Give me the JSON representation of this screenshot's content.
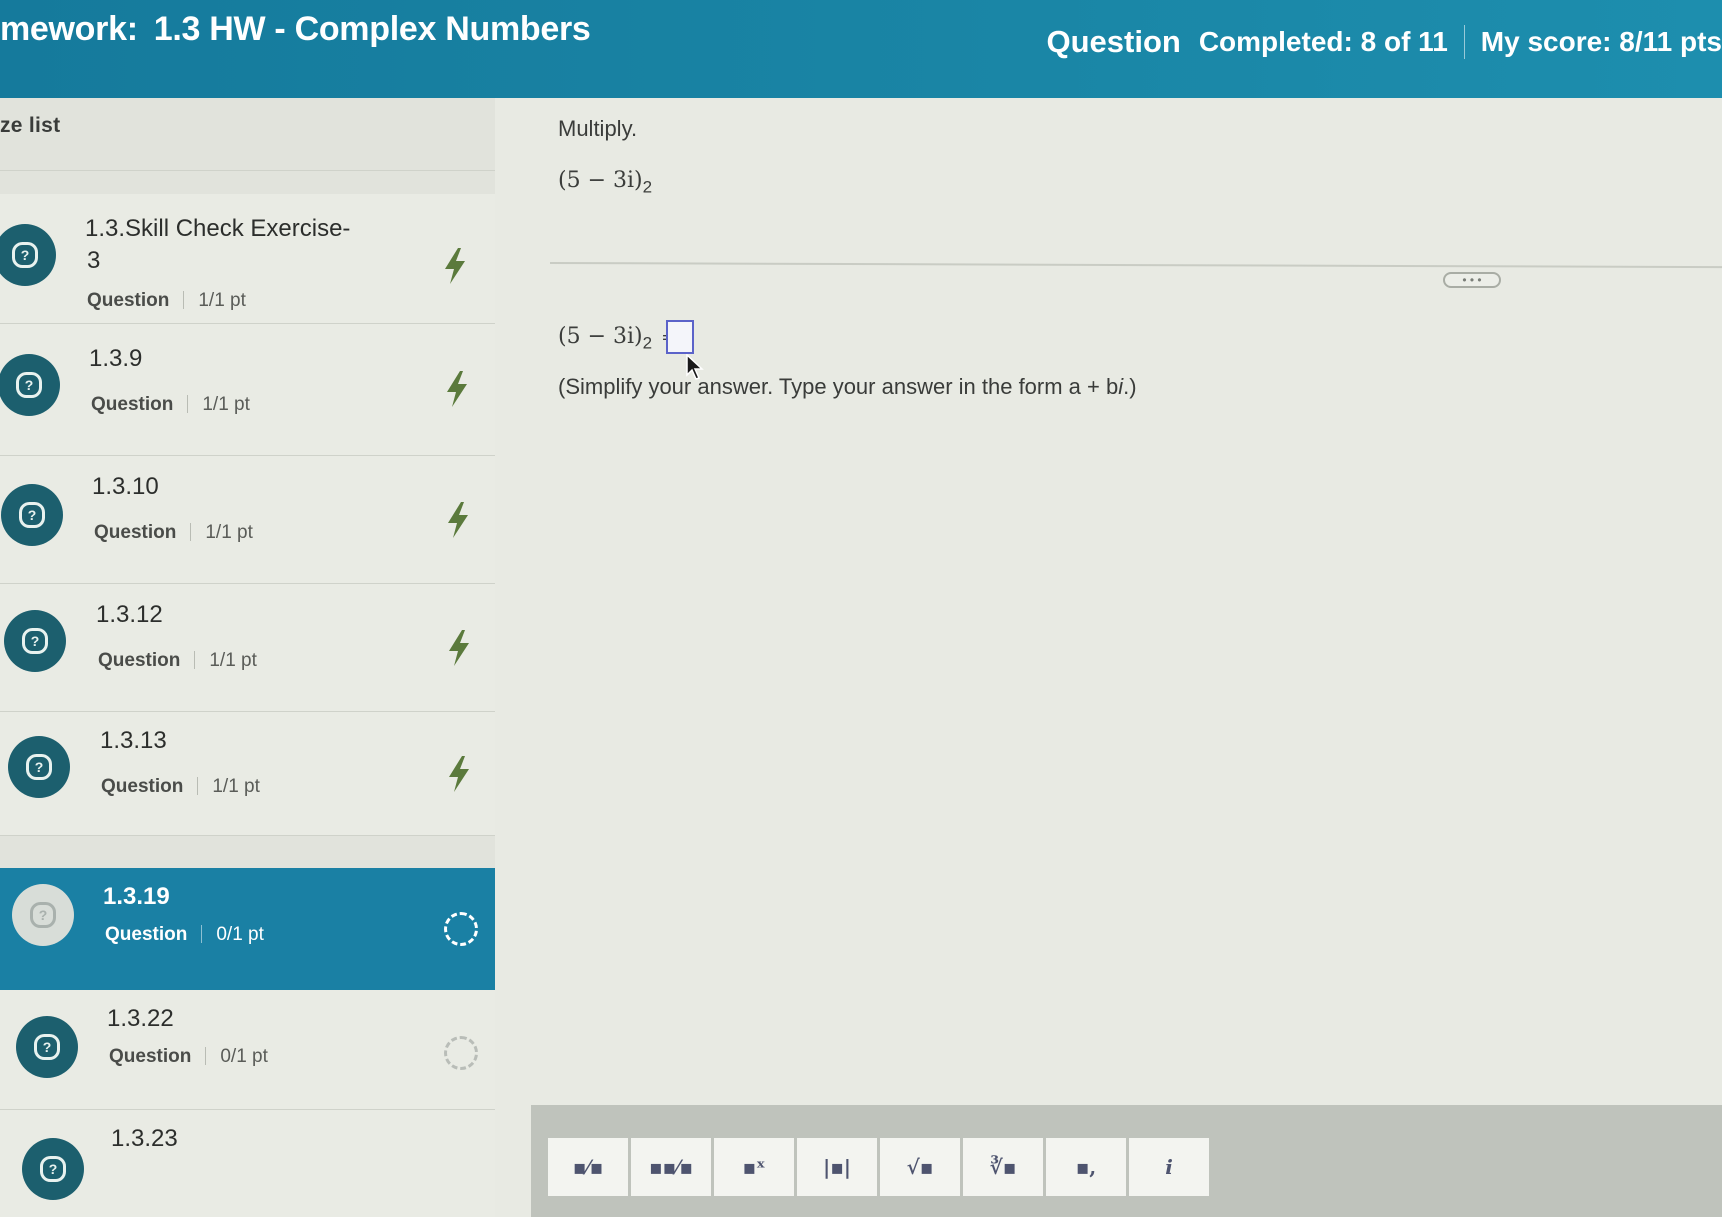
{
  "header": {
    "title_prefix": "mework:",
    "title": "1.3 HW - Complex Numbers",
    "question_label": "Question",
    "completed": "Completed: 8 of 11",
    "score": "My score: 8/11 pts"
  },
  "sidebar": {
    "list_label": "ze list",
    "items": [
      {
        "title": "1.3.Skill Check Exercise-",
        "title2": "3",
        "meta_label": "Question",
        "points": "1/1 pt",
        "status": "bolt",
        "active": false
      },
      {
        "title": "1.3.9",
        "meta_label": "Question",
        "points": "1/1 pt",
        "status": "bolt",
        "active": false
      },
      {
        "title": "1.3.10",
        "meta_label": "Question",
        "points": "1/1 pt",
        "status": "bolt",
        "active": false
      },
      {
        "title": "1.3.12",
        "meta_label": "Question",
        "points": "1/1 pt",
        "status": "bolt",
        "active": false
      },
      {
        "title": "1.3.13",
        "meta_label": "Question",
        "points": "1/1 pt",
        "status": "bolt",
        "active": false
      },
      {
        "title": "1.3.19",
        "meta_label": "Question",
        "points": "0/1 pt",
        "status": "ring",
        "active": true
      },
      {
        "title": "1.3.22",
        "meta_label": "Question",
        "points": "0/1 pt",
        "status": "ring",
        "active": false
      },
      {
        "title": "1.3.23",
        "active": false
      }
    ]
  },
  "question": {
    "instruction": "Multiply.",
    "expression": "(5 − 3i)",
    "expression_sub": "2",
    "answer_lhs": "(5 − 3i)",
    "answer_sub": "2",
    "equals": "=",
    "more_button": "• • •",
    "hint_pre": "(Simplify your answer. Type your answer in the form a + b",
    "hint_var": "i",
    "hint_post": ".)"
  },
  "palette": {
    "buttons": [
      {
        "name": "fraction-button",
        "symbol": "▪⁄▪"
      },
      {
        "name": "mixed-number-button",
        "symbol": "▪▪⁄▪"
      },
      {
        "name": "exponent-button",
        "symbol": "▪ˣ"
      },
      {
        "name": "absolute-value-button",
        "symbol": "|▪|"
      },
      {
        "name": "square-root-button",
        "symbol": "√▪"
      },
      {
        "name": "nth-root-button",
        "symbol": "∛▪"
      },
      {
        "name": "subscript-button",
        "symbol": "▪,"
      },
      {
        "name": "imaginary-i-button",
        "symbol": "i"
      }
    ]
  },
  "colors": {
    "header": "#1a86a6",
    "active_item": "#1a80a4",
    "icon_bg": "#1c5f6e",
    "bolt": "#5b7a3c",
    "answer_box_border": "#5b63c9"
  }
}
